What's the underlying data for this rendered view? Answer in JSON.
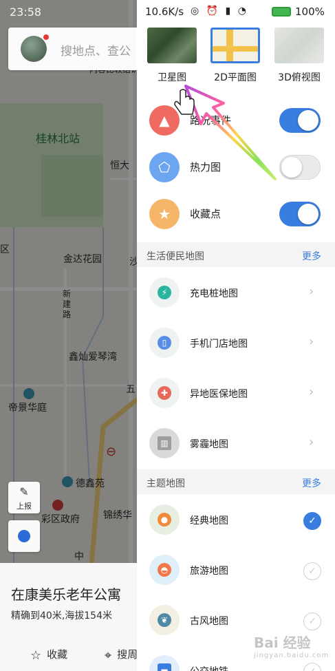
{
  "status_left": {
    "time": "23:58"
  },
  "status_right": {
    "speed": "10.6K/s",
    "icons": "◎ ⏰ ▮ ◔",
    "battery_pct": "100%"
  },
  "search": {
    "placeholder": "搜地点、查公"
  },
  "map_labels": {
    "guilin_north": "桂林北站",
    "hengda": "恒大",
    "qu": "区",
    "jinda": "金达花园",
    "sha": "沙",
    "xinjian": "新建路",
    "xinshan": "鑫灿爱琴湾",
    "wu": "五",
    "dijing": "帝景华庭",
    "dexin": "德鑫苑",
    "caiqu": "彩区政府",
    "jinxiu": "锦绣华",
    "zhong": "中",
    "top_partial": "内容比较结识"
  },
  "map_buttons": {
    "report_label": "上报"
  },
  "place_card": {
    "name": "在康美乐老年公寓",
    "sub": "精确到40米,海拔154米",
    "actions": {
      "favorite": "收藏",
      "search_nearby": "搜周"
    }
  },
  "drawer": {
    "layer_types": [
      {
        "label": "卫星图",
        "selected": false
      },
      {
        "label": "2D平面图",
        "selected": true
      },
      {
        "label": "3D俯视图",
        "selected": false
      }
    ],
    "toggles": [
      {
        "label": "路况事件",
        "on": true,
        "icon": "traffic-cone-icon",
        "color": "#ef6b61"
      },
      {
        "label": "热力图",
        "on": false,
        "icon": "heatmap-pentagon-icon",
        "color": "#6ca6f0"
      },
      {
        "label": "收藏点",
        "on": true,
        "icon": "star-icon",
        "color": "#f6b66a"
      }
    ],
    "life_section": {
      "title": "生活便民地图",
      "more": "更多",
      "items": [
        {
          "label": "充电桩地图",
          "icon": "charging-pile-icon"
        },
        {
          "label": "手机门店地图",
          "icon": "phone-store-icon"
        },
        {
          "label": "异地医保地图",
          "icon": "medical-insurance-icon"
        },
        {
          "label": "雾霾地图",
          "icon": "haze-city-icon"
        }
      ]
    },
    "theme_section": {
      "title": "主题地图",
      "more": "更多",
      "items": [
        {
          "label": "经典地图",
          "checked": true,
          "icon": "classic-map-icon"
        },
        {
          "label": "旅游地图",
          "checked": false,
          "icon": "hot-air-balloon-icon"
        },
        {
          "label": "古风地图",
          "checked": false,
          "icon": "bird-painting-icon"
        },
        {
          "label": "公交地铁",
          "checked": false,
          "icon": "bus-metro-icon"
        }
      ]
    }
  },
  "colors": {
    "accent": "#3a7de0"
  },
  "watermark": {
    "main": "Bai 经验",
    "sub": "jingyan.baidu.com"
  }
}
